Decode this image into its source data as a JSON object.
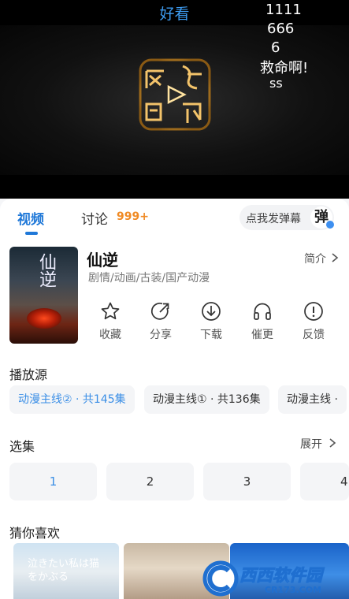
{
  "player": {
    "title": "好看",
    "danmaku": [
      "1111",
      "666",
      "6",
      "救命啊!",
      "ss"
    ],
    "logo_text": "网络视听"
  },
  "tabs": {
    "video": "视频",
    "discuss": "讨论",
    "discuss_count": "999+"
  },
  "danmaku_input": {
    "placeholder": "点我发弹幕",
    "button": "弹"
  },
  "show": {
    "title": "仙逆",
    "genres": "剧情/动画/古装/国产动漫",
    "intro_link": "简介",
    "poster_text": "仙逆"
  },
  "actions": [
    {
      "label": "收藏",
      "icon": "star-icon"
    },
    {
      "label": "分享",
      "icon": "share-icon"
    },
    {
      "label": "下载",
      "icon": "download-icon"
    },
    {
      "label": "催更",
      "icon": "headphones-icon"
    },
    {
      "label": "反馈",
      "icon": "alert-icon"
    }
  ],
  "sources": {
    "title": "播放源",
    "items": [
      "动漫主线② · 共145集",
      "动漫主线① · 共136集",
      "动漫主线 ·"
    ],
    "selected_index": 0
  },
  "episodes": {
    "title": "选集",
    "expand": "展开",
    "items": [
      "1",
      "2",
      "3",
      "4"
    ],
    "selected_index": 0
  },
  "recommend": {
    "title": "猜你喜欢",
    "cards": [
      {
        "caption": "泣きたい私は猫をかぶる"
      },
      {
        "caption": ""
      },
      {
        "caption": ""
      }
    ]
  },
  "watermark": {
    "brand": "西西软件园",
    "site": "CR173.COM"
  },
  "colors": {
    "accent": "#1f78d8",
    "count_orange": "#f08a24",
    "player_title": "#3d9bf0"
  }
}
